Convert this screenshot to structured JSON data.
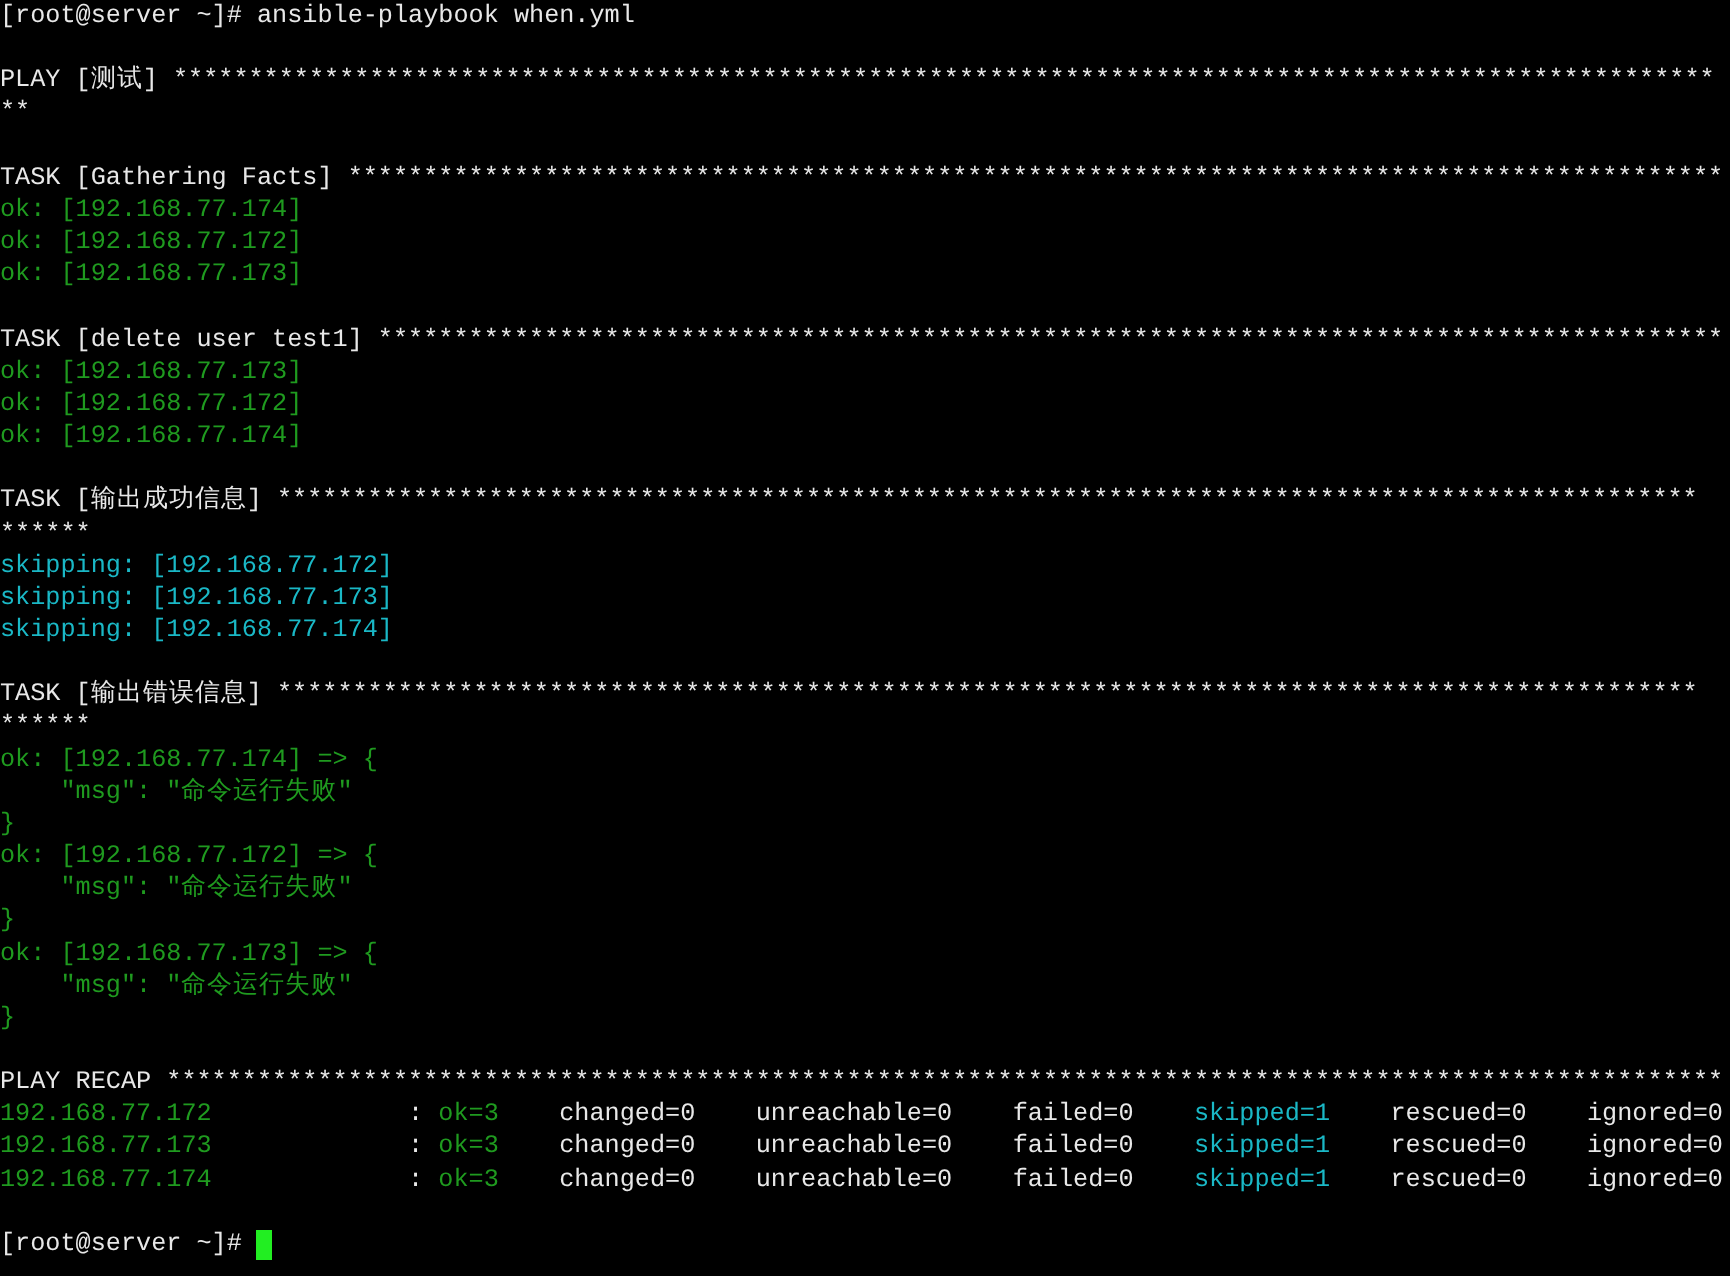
{
  "terminal": {
    "lines": [
      {
        "kind": "text",
        "color": "#e8e8e8",
        "text": "[root@server ~]# ansible-playbook when.yml"
      },
      {
        "kind": "blank"
      },
      {
        "kind": "text",
        "color": "#e8e8e8",
        "text": "PLAY [测试] ******************************************************************************************************"
      },
      {
        "kind": "text",
        "color": "#e8e8e8",
        "text": "**"
      },
      {
        "kind": "blank"
      },
      {
        "kind": "text",
        "color": "#e8e8e8",
        "text": "TASK [Gathering Facts] *******************************************************************************************"
      },
      {
        "kind": "text",
        "color": "#1f9a1f",
        "text": "ok: [192.168.77.174]"
      },
      {
        "kind": "text",
        "color": "#1f9a1f",
        "text": "ok: [192.168.77.172]"
      },
      {
        "kind": "text",
        "color": "#1f9a1f",
        "text": "ok: [192.168.77.173]"
      },
      {
        "kind": "blank"
      },
      {
        "kind": "text",
        "color": "#e8e8e8",
        "text": "TASK [delete user test1] *****************************************************************************************"
      },
      {
        "kind": "text",
        "color": "#1f9a1f",
        "text": "ok: [192.168.77.173]"
      },
      {
        "kind": "text",
        "color": "#1f9a1f",
        "text": "ok: [192.168.77.172]"
      },
      {
        "kind": "text",
        "color": "#1f9a1f",
        "text": "ok: [192.168.77.174]"
      },
      {
        "kind": "blank"
      },
      {
        "kind": "text",
        "color": "#e8e8e8",
        "text": "TASK [输出成功信息] **********************************************************************************************"
      },
      {
        "kind": "text",
        "color": "#e8e8e8",
        "text": "******"
      },
      {
        "kind": "text",
        "color": "#1ab8c6",
        "text": "skipping: [192.168.77.172]"
      },
      {
        "kind": "text",
        "color": "#1ab8c6",
        "text": "skipping: [192.168.77.173]"
      },
      {
        "kind": "text",
        "color": "#1ab8c6",
        "text": "skipping: [192.168.77.174]"
      },
      {
        "kind": "blank"
      },
      {
        "kind": "text",
        "color": "#e8e8e8",
        "text": "TASK [输出错误信息] **********************************************************************************************"
      },
      {
        "kind": "text",
        "color": "#e8e8e8",
        "text": "******"
      },
      {
        "kind": "text",
        "color": "#1f9a1f",
        "text": "ok: [192.168.77.174] => {"
      },
      {
        "kind": "text",
        "color": "#1f9a1f",
        "text": "    \"msg\": \"命令运行失败\""
      },
      {
        "kind": "text",
        "color": "#1f9a1f",
        "text": "}"
      },
      {
        "kind": "text",
        "color": "#1f9a1f",
        "text": "ok: [192.168.77.172] => {"
      },
      {
        "kind": "text",
        "color": "#1f9a1f",
        "text": "    \"msg\": \"命令运行失败\""
      },
      {
        "kind": "text",
        "color": "#1f9a1f",
        "text": "}"
      },
      {
        "kind": "text",
        "color": "#1f9a1f",
        "text": "ok: [192.168.77.173] => {"
      },
      {
        "kind": "text",
        "color": "#1f9a1f",
        "text": "    \"msg\": \"命令运行失败\""
      },
      {
        "kind": "text",
        "color": "#1f9a1f",
        "text": "}"
      },
      {
        "kind": "blank"
      },
      {
        "kind": "text",
        "color": "#e8e8e8",
        "text": "PLAY RECAP *******************************************************************************************************"
      },
      {
        "kind": "recap",
        "cells": [
          {
            "color": "#1f9a1f",
            "text": "192.168.77.172"
          },
          {
            "color": "#e8e8e8",
            "text": ":"
          },
          {
            "color": "#1f9a1f",
            "text": "ok=3"
          },
          {
            "color": "#e8e8e8",
            "text": "changed=0"
          },
          {
            "color": "#e8e8e8",
            "text": "unreachable=0"
          },
          {
            "color": "#e8e8e8",
            "text": "failed=0"
          },
          {
            "color": "#1ab8c6",
            "text": "skipped=1"
          },
          {
            "color": "#e8e8e8",
            "text": "rescued=0"
          },
          {
            "color": "#e8e8e8",
            "text": "ignored=0"
          }
        ]
      },
      {
        "kind": "recap",
        "cells": [
          {
            "color": "#1f9a1f",
            "text": "192.168.77.173"
          },
          {
            "color": "#e8e8e8",
            "text": ":"
          },
          {
            "color": "#1f9a1f",
            "text": "ok=3"
          },
          {
            "color": "#e8e8e8",
            "text": "changed=0"
          },
          {
            "color": "#e8e8e8",
            "text": "unreachable=0"
          },
          {
            "color": "#e8e8e8",
            "text": "failed=0"
          },
          {
            "color": "#1ab8c6",
            "text": "skipped=1"
          },
          {
            "color": "#e8e8e8",
            "text": "rescued=0"
          },
          {
            "color": "#e8e8e8",
            "text": "ignored=0"
          }
        ]
      },
      {
        "kind": "recap",
        "cells": [
          {
            "color": "#1f9a1f",
            "text": "192.168.77.174"
          },
          {
            "color": "#e8e8e8",
            "text": ":"
          },
          {
            "color": "#1f9a1f",
            "text": "ok=3"
          },
          {
            "color": "#e8e8e8",
            "text": "changed=0"
          },
          {
            "color": "#e8e8e8",
            "text": "unreachable=0"
          },
          {
            "color": "#e8e8e8",
            "text": "failed=0"
          },
          {
            "color": "#1ab8c6",
            "text": "skipped=1"
          },
          {
            "color": "#e8e8e8",
            "text": "rescued=0"
          },
          {
            "color": "#e8e8e8",
            "text": "ignored=0"
          }
        ]
      },
      {
        "kind": "blank"
      },
      {
        "kind": "text",
        "color": "#e8e8e8",
        "text": "[root@server ~]#",
        "cursor": true
      }
    ]
  }
}
